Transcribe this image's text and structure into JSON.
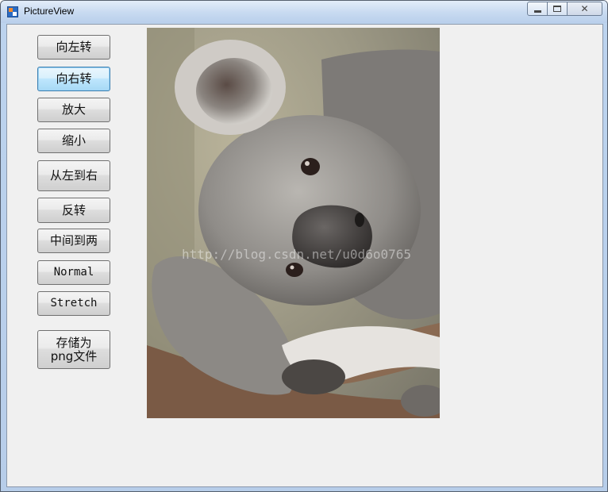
{
  "window": {
    "title": "PictureView"
  },
  "buttons": {
    "rotate_left": "向左转",
    "rotate_right": "向右转",
    "zoom_in": "放大",
    "zoom_out": "缩小",
    "left_to_right": "从左到右",
    "flip": "反转",
    "center_out": "中间到两",
    "normal": "Normal",
    "stretch": "Stretch",
    "save_png_line1": "存储为",
    "save_png_line2": "png文件"
  },
  "picture": {
    "subject": "koala photo",
    "watermark": "http://blog.csdn.net/u0d6o0765"
  }
}
